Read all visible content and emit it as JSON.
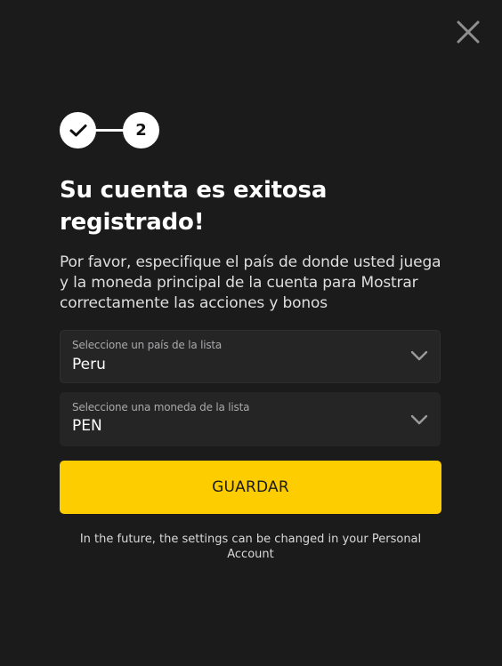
{
  "dialog": {
    "close_icon": "close-icon",
    "steps": {
      "step1_icon": "checkmark-icon",
      "step2_label": "2"
    },
    "title": "Su cuenta es exitosa registrado!",
    "description": "Por favor, especifique el país de donde usted juega y la moneda principal de la cuenta para Mostrar correctamente las acciones y bonos",
    "country_select": {
      "label": "Seleccione un país de la lista",
      "value": "Peru",
      "icon": "chevron-down-icon"
    },
    "currency_select": {
      "label": "Seleccione una moneda de la lista",
      "value": "PEN",
      "icon": "chevron-down-icon"
    },
    "save_button_label": "GUARDAR",
    "footer_note": "In the future, the settings can be changed in your Personal Account"
  },
  "colors": {
    "background": "#1b1b1c",
    "field_background": "#252526",
    "accent": "#fecd00",
    "text": "#ffffff",
    "muted_text": "#a9a9ab"
  }
}
